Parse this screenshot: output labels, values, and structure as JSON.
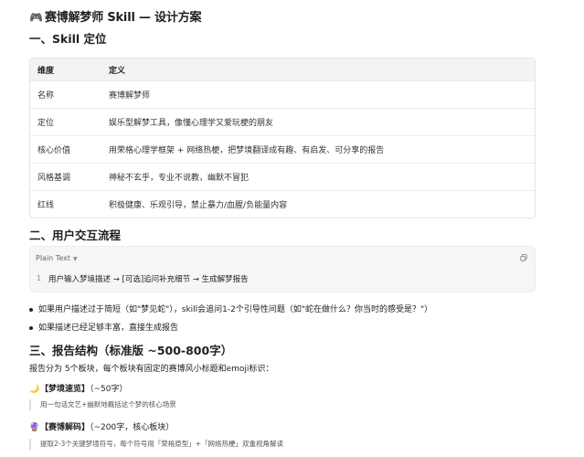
{
  "title_emoji": "🎮",
  "title": "赛博解梦师 Skill — 设计方案",
  "section1": {
    "heading": "一、Skill 定位",
    "table": {
      "headers": [
        "维度",
        "定义"
      ],
      "rows": [
        [
          "名称",
          "赛博解梦师"
        ],
        [
          "定位",
          "娱乐型解梦工具，像懂心理学又爱玩梗的朋友"
        ],
        [
          "核心价值",
          "用荣格心理学框架 + 网络热梗，把梦境翻译成有趣、有启发、可分享的报告"
        ],
        [
          "风格基调",
          "神秘不玄乎，专业不说教，幽默不冒犯"
        ],
        [
          "红线",
          "积极健康、乐观引导，禁止暴力/血腥/负能量内容"
        ]
      ]
    }
  },
  "section2": {
    "heading": "二、用户交互流程",
    "code": {
      "language": "Plain Text",
      "line_number": "1",
      "line": "用户输入梦境描述 → [可选]追问补充细节 → 生成解梦报告"
    },
    "bullets": [
      "如果用户描述过于简短（如\"梦见蛇\"），skill会追问1-2个引导性问题（如\"蛇在做什么？你当时的感受是？\"）",
      "如果描述已经足够丰富，直接生成报告"
    ]
  },
  "section3": {
    "heading": "三、报告结构（标准版 ~500-800字）",
    "intro": "报告分为 5个板块，每个板块有固定的赛博风小标题和emoji标识：",
    "blocks": [
      {
        "emoji": "🌙",
        "title": "【梦境速览】",
        "note": "（~50字）",
        "desc": "用一句话文艺+幽默地概括这个梦的核心场景"
      },
      {
        "emoji": "🔮",
        "title": "【赛博解码】",
        "note": "（~200字，核心板块）",
        "desc": "提取2-3个关键梦境符号，每个符号用「荣格原型」+「网络热梗」双重视角解读"
      }
    ]
  }
}
